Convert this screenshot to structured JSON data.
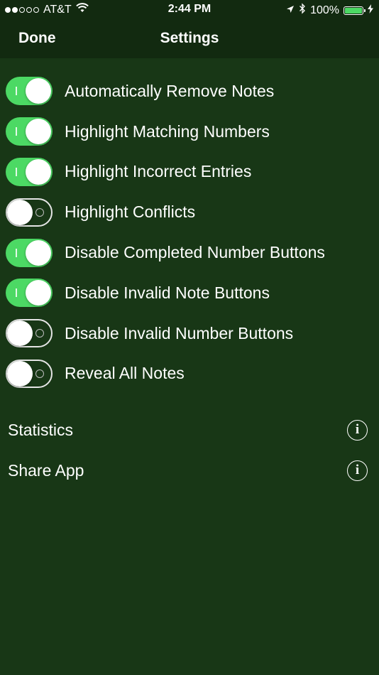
{
  "status_bar": {
    "carrier": "AT&T",
    "time": "2:44 PM",
    "battery_percent": "100%",
    "signal_bars_filled": 2,
    "signal_bars_total": 5,
    "icons": [
      "wifi-icon",
      "location-arrow-icon",
      "bluetooth-icon",
      "battery-icon",
      "charging-bolt-icon"
    ],
    "battery_color": "#4cd964"
  },
  "nav": {
    "done_label": "Done",
    "title": "Settings"
  },
  "settings": [
    {
      "label": "Automatically Remove Notes",
      "on": true
    },
    {
      "label": "Highlight Matching Numbers",
      "on": true
    },
    {
      "label": "Highlight Incorrect Entries",
      "on": true
    },
    {
      "label": "Highlight Conflicts",
      "on": false
    },
    {
      "label": "Disable Completed Number Buttons",
      "on": true
    },
    {
      "label": "Disable Invalid Note Buttons",
      "on": true
    },
    {
      "label": "Disable Invalid Number Buttons",
      "on": false
    },
    {
      "label": "Reveal All Notes",
      "on": false
    }
  ],
  "info_items": [
    {
      "label": "Statistics",
      "icon": "info-icon"
    },
    {
      "label": "Share App",
      "icon": "info-icon"
    }
  ],
  "colors": {
    "background": "#183716",
    "bar_background": "#122a10",
    "toggle_on": "#4cd964",
    "text": "#ffffff"
  }
}
